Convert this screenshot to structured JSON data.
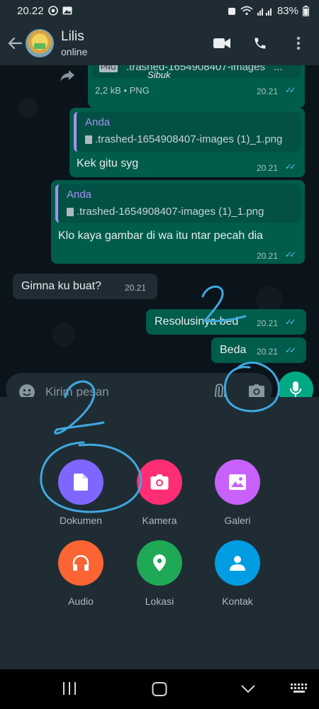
{
  "status_bar": {
    "time": "20.22",
    "battery": "83%"
  },
  "header": {
    "contact_name": "Lilis",
    "contact_status": "online"
  },
  "messages": {
    "file_msg": {
      "partial_filename": ".trashed-1654908407-images",
      "file_type": "PNG",
      "meta": "2,2 kB • PNG",
      "time": "20.21"
    },
    "msg1": {
      "quote_name": "Anda",
      "quote_file": ".trashed-1654908407-images (1)_1.png",
      "text": "Kek gitu syg",
      "time": "20.21"
    },
    "msg2": {
      "quote_name": "Anda",
      "quote_file": ".trashed-1654908407-images (1)_1.png",
      "text": "Klo kaya gambar di wa itu ntar pecah dia",
      "time": "20.21"
    },
    "msg3": {
      "text": "Gimna ku buat?",
      "time": "20.21"
    },
    "msg4": {
      "text": "Resolusinya bed",
      "time": "20.21"
    },
    "msg5": {
      "text": "Beda",
      "time": "20.21"
    }
  },
  "handwriting": {
    "note_top": "Sibuk"
  },
  "input": {
    "placeholder": "Kirim pesan"
  },
  "attachments": [
    {
      "label": "Dokumen",
      "color": "#7f66ff",
      "icon": "document-icon"
    },
    {
      "label": "Kamera",
      "color": "#ff2e74",
      "icon": "camera-icon"
    },
    {
      "label": "Galeri",
      "color": "#c861fa",
      "icon": "gallery-icon"
    },
    {
      "label": "Audio",
      "color": "#fa6533",
      "icon": "headphones-icon"
    },
    {
      "label": "Lokasi",
      "color": "#1fa855",
      "icon": "location-pin-icon"
    },
    {
      "label": "Kontak",
      "color": "#009de2",
      "icon": "contact-person-icon"
    }
  ],
  "colors": {
    "accent": "#00a884",
    "outgoing": "#005c4b",
    "incoming": "#1f2c34",
    "read_ticks": "#53bdeb",
    "annotation": "#3fa9e0"
  }
}
